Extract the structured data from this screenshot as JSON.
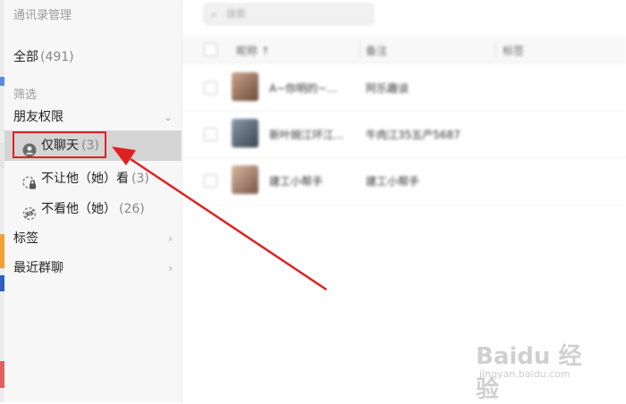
{
  "sidebar": {
    "title": "通讯录管理",
    "all": {
      "label": "全部",
      "count": "(491)"
    },
    "filter_label": "筛选",
    "groups": {
      "friend_permission": "朋友权限",
      "tags": "标签",
      "recent_groups": "最近群聊"
    },
    "permission_items": [
      {
        "label": "仅聊天",
        "count": "(3)",
        "icon": "user-circle-icon"
      },
      {
        "label": "不让他（她）看",
        "count": "(3)",
        "icon": "lock-eye-icon"
      },
      {
        "label": "不看他（她）",
        "count": "(26)",
        "icon": "hidden-eye-icon"
      }
    ]
  },
  "main": {
    "search_placeholder": "搜索",
    "columns": [
      "昵称 ↑",
      "备注",
      "标签"
    ],
    "rows": [
      {
        "name": "A~你明的~...",
        "remark": "阿乐趣谈"
      },
      {
        "name": "新叶婉江环江...",
        "remark": "牛肉江35五产5687"
      },
      {
        "name": "建工小帮手",
        "remark": "建工小帮手"
      }
    ]
  },
  "colors": {
    "selected_row": "#d4d4d4",
    "annotation_red": "#e02020",
    "sidebar_bg": "#f7f7f7"
  },
  "watermark": {
    "logo_text": "Baidu 经验",
    "url": "jingyan.baidu.com"
  }
}
